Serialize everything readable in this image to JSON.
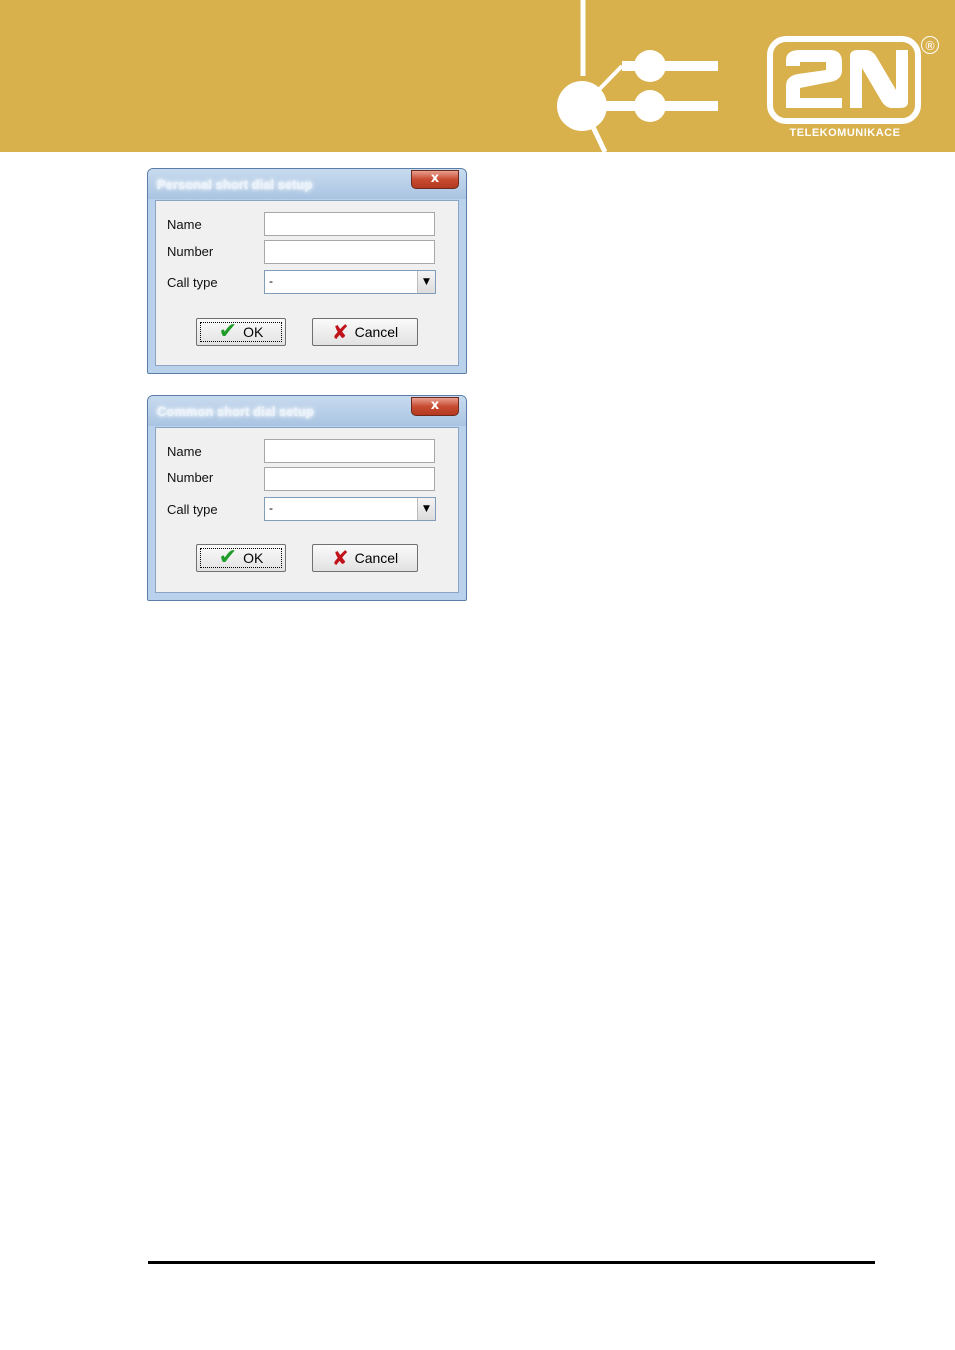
{
  "header": {
    "logo_text": "2N",
    "logo_subtitle": "TELEKOMUNIKACE",
    "registered_mark": "®",
    "colors": {
      "background": "#d8b04c",
      "logo": "#ffffff"
    }
  },
  "dialogs": [
    {
      "title": "Personal short dial setup",
      "close_label": "x",
      "name_label": "Name",
      "number_label": "Number",
      "call_type_label": "Call type",
      "name_value": "",
      "number_value": "",
      "call_type_value": "-",
      "ok_label": "OK",
      "cancel_label": "Cancel"
    },
    {
      "title": "Common short dial setup",
      "close_label": "x",
      "name_label": "Name",
      "number_label": "Number",
      "call_type_label": "Call type",
      "name_value": "",
      "number_value": "",
      "call_type_value": "-",
      "ok_label": "OK",
      "cancel_label": "Cancel"
    }
  ],
  "icons": {
    "ok": "check-icon",
    "cancel": "x-icon",
    "dropdown": "chevron-down-icon",
    "close": "close-icon"
  }
}
